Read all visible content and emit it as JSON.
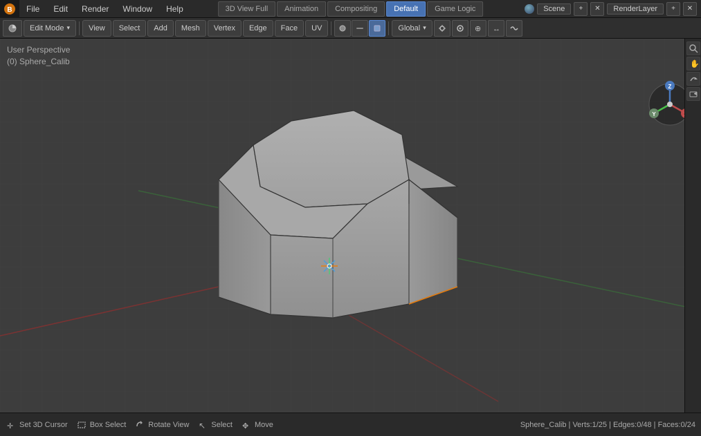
{
  "topMenu": {
    "items": [
      "File",
      "Edit",
      "Render",
      "Window",
      "Help"
    ],
    "tabs": [
      {
        "label": "3D View Full",
        "active": false
      },
      {
        "label": "Animation",
        "active": false
      },
      {
        "label": "Compositing",
        "active": false
      },
      {
        "label": "Default",
        "active": true
      },
      {
        "label": "Game Logic",
        "active": false
      }
    ],
    "scene": "Scene",
    "renderlayer": "RenderLayer"
  },
  "toolbar": {
    "mode": "Edit Mode",
    "view": "View",
    "select": "Select",
    "add": "Add",
    "mesh": "Mesh",
    "vertex": "Vertex",
    "edge": "Edge",
    "face": "Face",
    "uv": "UV",
    "transform": "Global"
  },
  "viewport": {
    "label1": "User Perspective",
    "label2": "(0) Sphere_Calib"
  },
  "statusBar": {
    "setCursor": "Set 3D Cursor",
    "boxSelect": "Box Select",
    "rotateView": "Rotate View",
    "select": "Select",
    "move": "Move",
    "right": "Sphere_Calib | Verts:1/25 | Edges:0/48 | Faces:0/24"
  },
  "icons": {
    "blender": "⬡",
    "cursor": "✛",
    "box": "▭",
    "rotate": "↻",
    "select": "↖",
    "move": "✥"
  }
}
